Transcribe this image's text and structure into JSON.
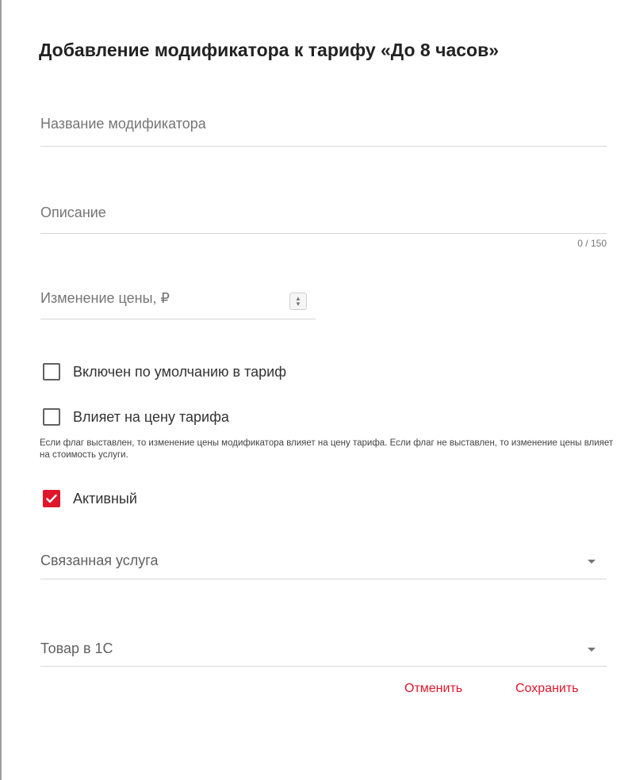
{
  "dialog": {
    "title": "Добавление модификатора к тарифу «До 8 часов»"
  },
  "fields": {
    "name": {
      "placeholder": "Название модификатора",
      "value": ""
    },
    "description": {
      "placeholder": "Описание",
      "value": "",
      "counter": "0 / 150"
    },
    "price_change": {
      "placeholder": "Изменение цены, ₽",
      "value": ""
    }
  },
  "checkboxes": {
    "default_included": {
      "label": "Включен по умолчанию в тариф",
      "checked": false
    },
    "affects_price": {
      "label": "Влияет на цену тарифа",
      "checked": false,
      "hint": "Если флаг выставлен, то изменение цены модификатора влияет на цену тарифа. Если флаг не выставлен, то изменение цены влияет на стоимость услуги."
    },
    "active": {
      "label": "Активный",
      "checked": true
    }
  },
  "selects": {
    "linked_service": {
      "label": "Связанная услуга",
      "icon": "chevron-down-icon"
    },
    "product_1c": {
      "label": "Товар в 1С",
      "icon": "chevron-down-icon"
    }
  },
  "actions": {
    "cancel_label": "Отменить",
    "save_label": "Сохранить"
  },
  "colors": {
    "accent": "#e0162b",
    "text": "#212121",
    "muted": "#757575",
    "divider": "#d6d6d6"
  }
}
